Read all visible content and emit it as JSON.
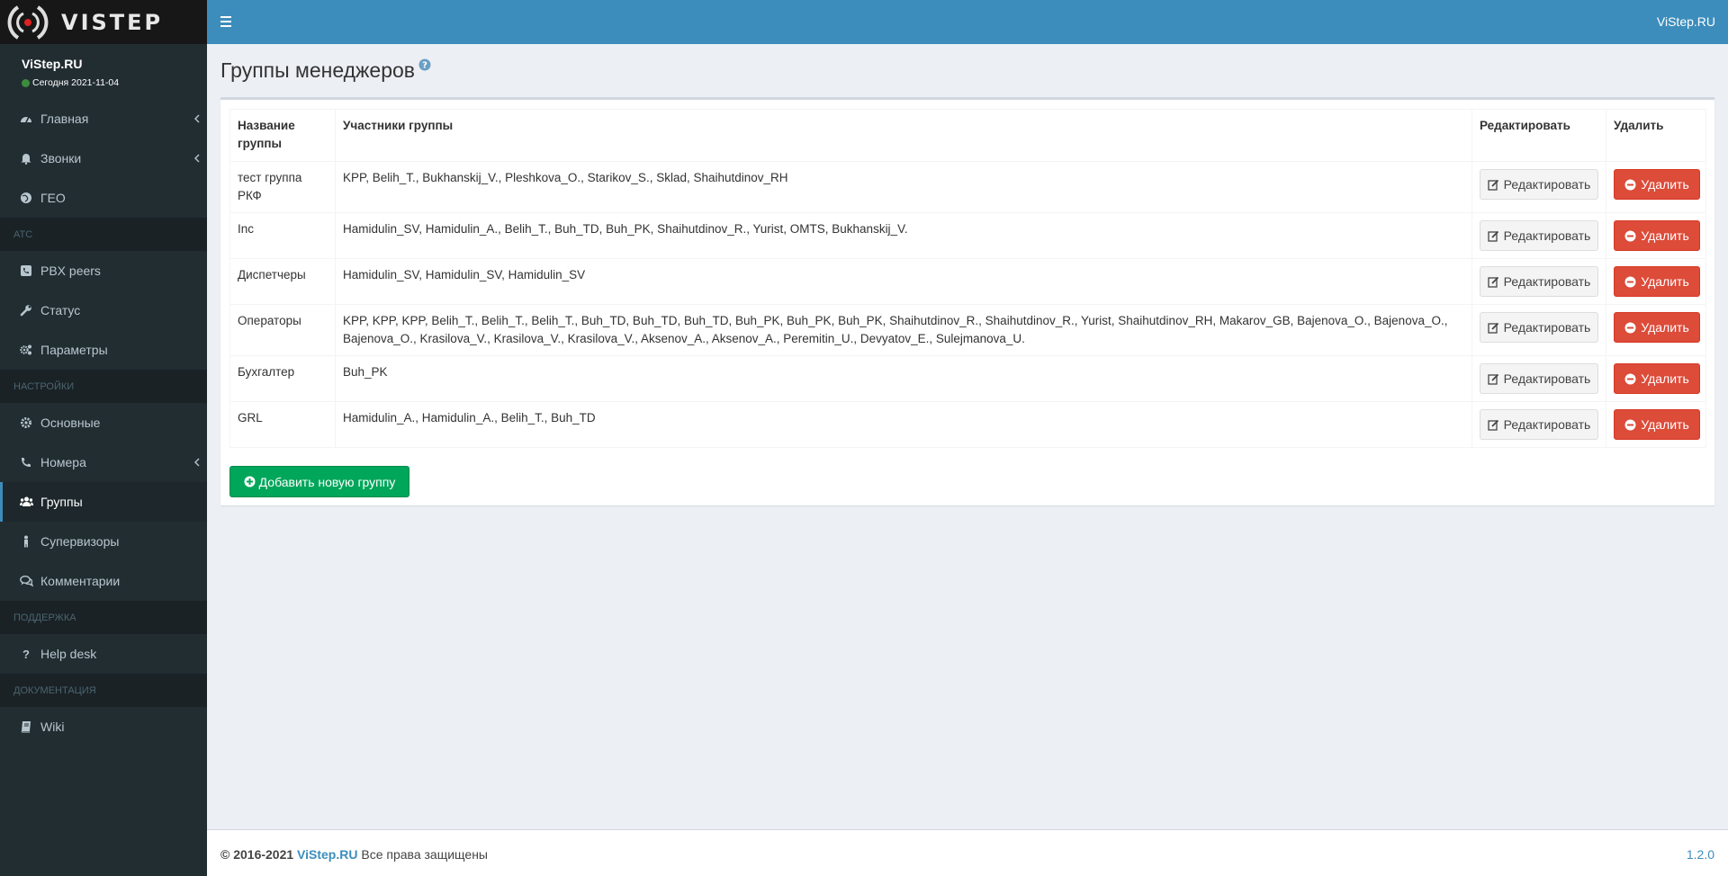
{
  "brand": {
    "logo_text": "VISTEP",
    "top_right": "ViStep.RU"
  },
  "user": {
    "name": "ViStep.RU",
    "status": "Сегодня 2021-11-04"
  },
  "sidebar": {
    "items": [
      {
        "label": "Главная",
        "icon": "dashboard-icon"
      },
      {
        "label": "Звонки",
        "icon": "bell-icon"
      },
      {
        "label": "ГЕО",
        "icon": "globe-icon"
      },
      {
        "header": "АТС"
      },
      {
        "label": "PBX peers",
        "icon": "phone-square-icon"
      },
      {
        "label": "Статус",
        "icon": "wrench-icon"
      },
      {
        "label": "Параметры",
        "icon": "cogs-icon"
      },
      {
        "header": "НАСТРОЙКИ"
      },
      {
        "label": "Основные",
        "icon": "gear-icon"
      },
      {
        "label": "Номера",
        "icon": "phone-icon"
      },
      {
        "label": "Группы",
        "icon": "users-icon"
      },
      {
        "label": "Супервизоры",
        "icon": "child-icon"
      },
      {
        "label": "Комментарии",
        "icon": "comments-icon"
      },
      {
        "header": "ПОДДЕРЖКА"
      },
      {
        "label": "Help desk",
        "icon": "question-icon"
      },
      {
        "header": "ДОКУМЕНТАЦИЯ"
      },
      {
        "label": "Wiki",
        "icon": "book-icon"
      }
    ]
  },
  "page": {
    "title": "Группы менеджеров"
  },
  "table": {
    "headers": [
      "Название группы",
      "Участники группы",
      "Редактировать",
      "Удалить"
    ],
    "edit_label": "Редактировать",
    "delete_label": "Удалить",
    "rows": [
      {
        "name": "тест группа РКФ",
        "members": "KPP, Belih_T., Bukhanskij_V., Pleshkova_O., Starikov_S., Sklad, Shaihutdinov_RH"
      },
      {
        "name": "Inc",
        "members": "Hamidulin_SV, Hamidulin_A., Belih_T., Buh_TD, Buh_PK, Shaihutdinov_R., Yurist, OMTS, Bukhanskij_V."
      },
      {
        "name": "Диспетчеры",
        "members": "Hamidulin_SV, Hamidulin_SV, Hamidulin_SV"
      },
      {
        "name": "Операторы",
        "members": "KPP, KPP, KPP, Belih_T., Belih_T., Belih_T., Buh_TD, Buh_TD, Buh_TD, Buh_PK, Buh_PK, Buh_PK, Shaihutdinov_R., Shaihutdinov_R., Yurist, Shaihutdinov_RH, Makarov_GB, Bajenova_O., Bajenova_O., Bajenova_O., Krasilova_V., Krasilova_V., Krasilova_V., Aksenov_A., Aksenov_A., Peremitin_U., Devyatov_E., Sulejmanova_U."
      },
      {
        "name": "Бухгалтер",
        "members": "Buh_PK"
      },
      {
        "name": "GRL",
        "members": "Hamidulin_A., Hamidulin_A., Belih_T., Buh_TD"
      }
    ]
  },
  "add_button": "Добавить новую группу",
  "footer": {
    "copyright": "© 2016-2021",
    "brand": "ViStep.RU",
    "rights": "Все права защищены",
    "version": "1.2.0"
  },
  "colors": {
    "header": "#3c8dbc",
    "sidebar": "#222d32",
    "danger": "#dd4b39",
    "success": "#00a65a"
  }
}
